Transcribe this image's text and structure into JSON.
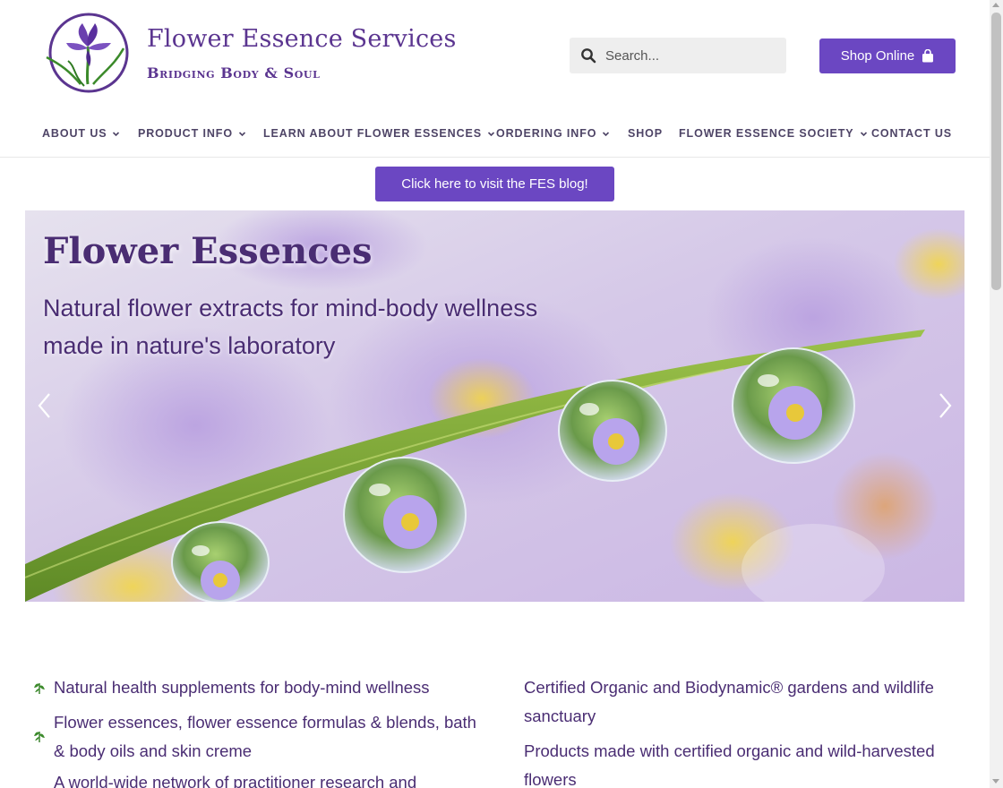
{
  "brand": {
    "title": "Flower Essence Services",
    "tagline": "Bridging Body & Soul",
    "logo_icon": "iris-flower-logo"
  },
  "search": {
    "placeholder": "Search...",
    "icon": "search-icon"
  },
  "shop_button": {
    "label": "Shop Online",
    "icon": "shopping-bag-icon"
  },
  "nav": {
    "items": [
      {
        "label": "ABOUT US",
        "has_dropdown": true
      },
      {
        "label": "PRODUCT INFO",
        "has_dropdown": true
      },
      {
        "label": "LEARN ABOUT FLOWER ESSENCES",
        "has_dropdown": true
      },
      {
        "label": "ORDERING INFO",
        "has_dropdown": true
      },
      {
        "label": "SHOP",
        "has_dropdown": false
      },
      {
        "label": "FLOWER ESSENCE SOCIETY",
        "has_dropdown": true
      },
      {
        "label": "CONTACT US",
        "has_dropdown": false
      }
    ]
  },
  "blog_button": {
    "label": "Click here to visit the FES blog!"
  },
  "hero": {
    "title": "Flower Essences",
    "subtitle": "Natural flower extracts for mind-body wellness made in nature's laboratory",
    "prev_icon": "chevron-left-icon",
    "next_icon": "chevron-right-icon"
  },
  "features": {
    "left": [
      "Natural health supplements for body-mind wellness",
      "Flower essences, flower essence formulas & blends, bath & body oils and skin creme",
      "A world-wide network of practitioner research and"
    ],
    "right": [
      "Certified Organic and Biodynamic® gardens and wildlife sanctuary",
      "Products made with certified organic and wild-harvested flowers"
    ],
    "bullet_icon": "leaf-icon"
  },
  "colors": {
    "accent": "#6b47c2",
    "brand_text": "#5b3590",
    "nav_text": "#4e4466",
    "body_text": "#4a2d73"
  }
}
